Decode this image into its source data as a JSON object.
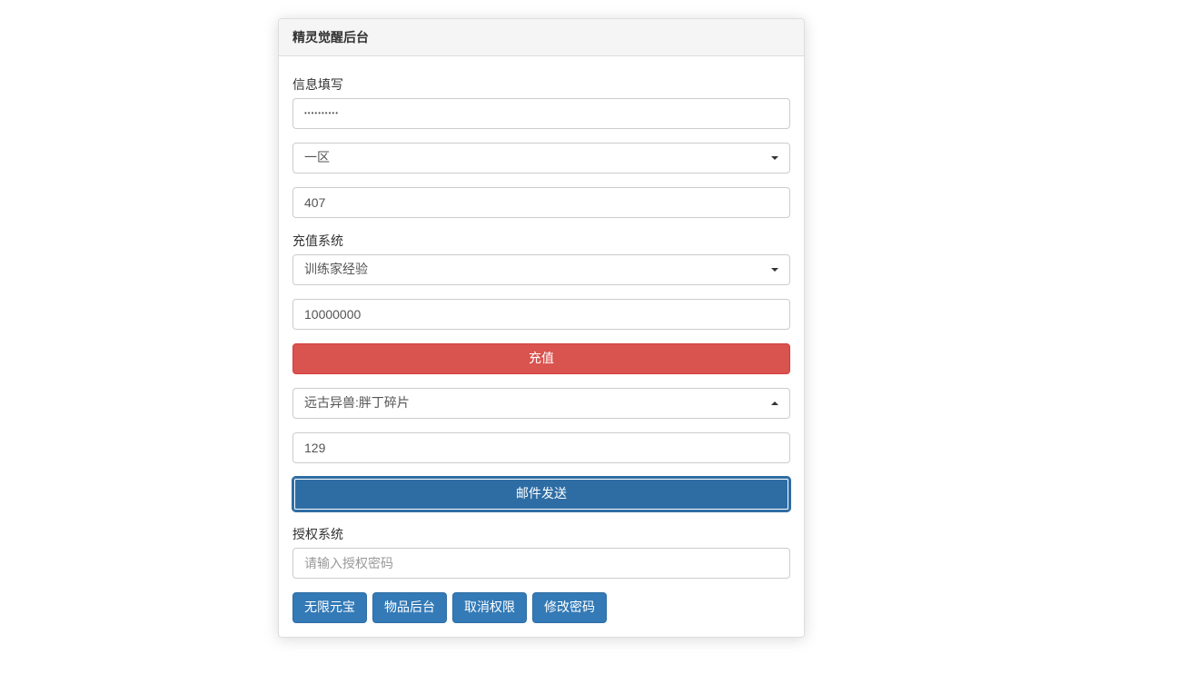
{
  "panel": {
    "title": "精灵觉醒后台"
  },
  "infoSection": {
    "label": "信息填写",
    "passwordValue": "••••••••••",
    "zoneSelected": "一区",
    "numberValue": "407"
  },
  "rechargeSection": {
    "label": "充值系统",
    "typeSelected": "训练家经验",
    "amountValue": "10000000",
    "rechargeButton": "充值",
    "itemSelected": "远古异兽:胖丁碎片",
    "itemCountValue": "129",
    "mailButton": "邮件发送"
  },
  "authSection": {
    "label": "授权系统",
    "authPlaceholder": "请输入授权密码"
  },
  "actions": {
    "unlimitedGold": "无限元宝",
    "itemBackend": "物品后台",
    "cancelAuth": "取消权限",
    "changePassword": "修改密码"
  }
}
